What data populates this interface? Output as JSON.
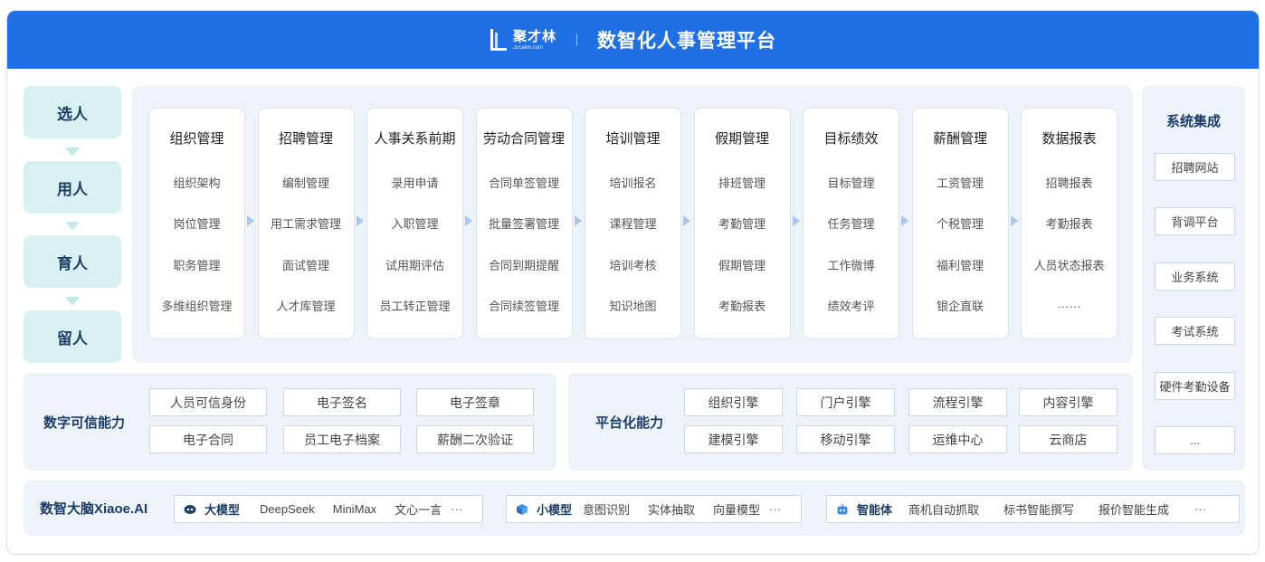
{
  "header": {
    "logo_cn": "聚才林",
    "logo_en": "Jucailin.com",
    "title": "数智化人事管理平台"
  },
  "stages": [
    "选人",
    "用人",
    "育人",
    "留人"
  ],
  "modules": [
    {
      "title": "组织管理",
      "items": [
        "组织架构",
        "岗位管理",
        "职务管理",
        "多维组织管理"
      ]
    },
    {
      "title": "招聘管理",
      "items": [
        "编制管理",
        "用工需求管理",
        "面试管理",
        "人才库管理"
      ]
    },
    {
      "title": "人事关系前期",
      "items": [
        "录用申请",
        "入职管理",
        "试用期评估",
        "员工转正管理"
      ]
    },
    {
      "title": "劳动合同管理",
      "items": [
        "合同单签管理",
        "批量签署管理",
        "合同到期提醒",
        "合同续签管理"
      ]
    },
    {
      "title": "培训管理",
      "items": [
        "培训报名",
        "课程管理",
        "培训考核",
        "知识地图"
      ]
    },
    {
      "title": "假期管理",
      "items": [
        "排班管理",
        "考勤管理",
        "假期管理",
        "考勤报表"
      ]
    },
    {
      "title": "目标绩效",
      "items": [
        "目标管理",
        "任务管理",
        "工作微博",
        "绩效考评"
      ]
    },
    {
      "title": "薪酬管理",
      "items": [
        "工资管理",
        "个税管理",
        "福利管理",
        "银企直联"
      ]
    },
    {
      "title": "数据报表",
      "items": [
        "招聘报表",
        "考勤报表",
        "人员状态报表",
        "……"
      ]
    }
  ],
  "system_integration": {
    "title": "系统集成",
    "items": [
      "招聘网站",
      "背调平台",
      "业务系统",
      "考试系统",
      "硬件考勤设备",
      "..."
    ]
  },
  "digital_trust": {
    "title": "数字可信能力",
    "items": [
      "人员可信身份",
      "电子签名",
      "电子签章",
      "电子合同",
      "员工电子档案",
      "薪酬二次验证"
    ]
  },
  "platform": {
    "title": "平台化能力",
    "items": [
      "组织引擎",
      "门户引擎",
      "流程引擎",
      "内容引擎",
      "建模引擎",
      "移动引擎",
      "运维中心",
      "云商店"
    ]
  },
  "ai": {
    "title": "数智大脑Xiaoe.AI",
    "groups": [
      {
        "icon": "robot-face-icon",
        "label": "大模型",
        "tags": [
          "DeepSeek",
          "MiniMax",
          "文心一言"
        ],
        "more": "···"
      },
      {
        "icon": "cube-icon",
        "label": "小模型",
        "tags": [
          "意图识别",
          "实体抽取",
          "向量模型"
        ],
        "more": "···"
      },
      {
        "icon": "agent-robot-icon",
        "label": "智能体",
        "tags": [
          "商机自动抓取",
          "标书智能撰写",
          "报价智能生成"
        ],
        "more": "···"
      }
    ]
  },
  "colors": {
    "header_blue": "#1f6fe5",
    "panel_bg": "#eef3fa",
    "stage_bg": "#d9f1f3",
    "heading_navy": "#1b3d66",
    "arrow": "#a9c6ee"
  }
}
